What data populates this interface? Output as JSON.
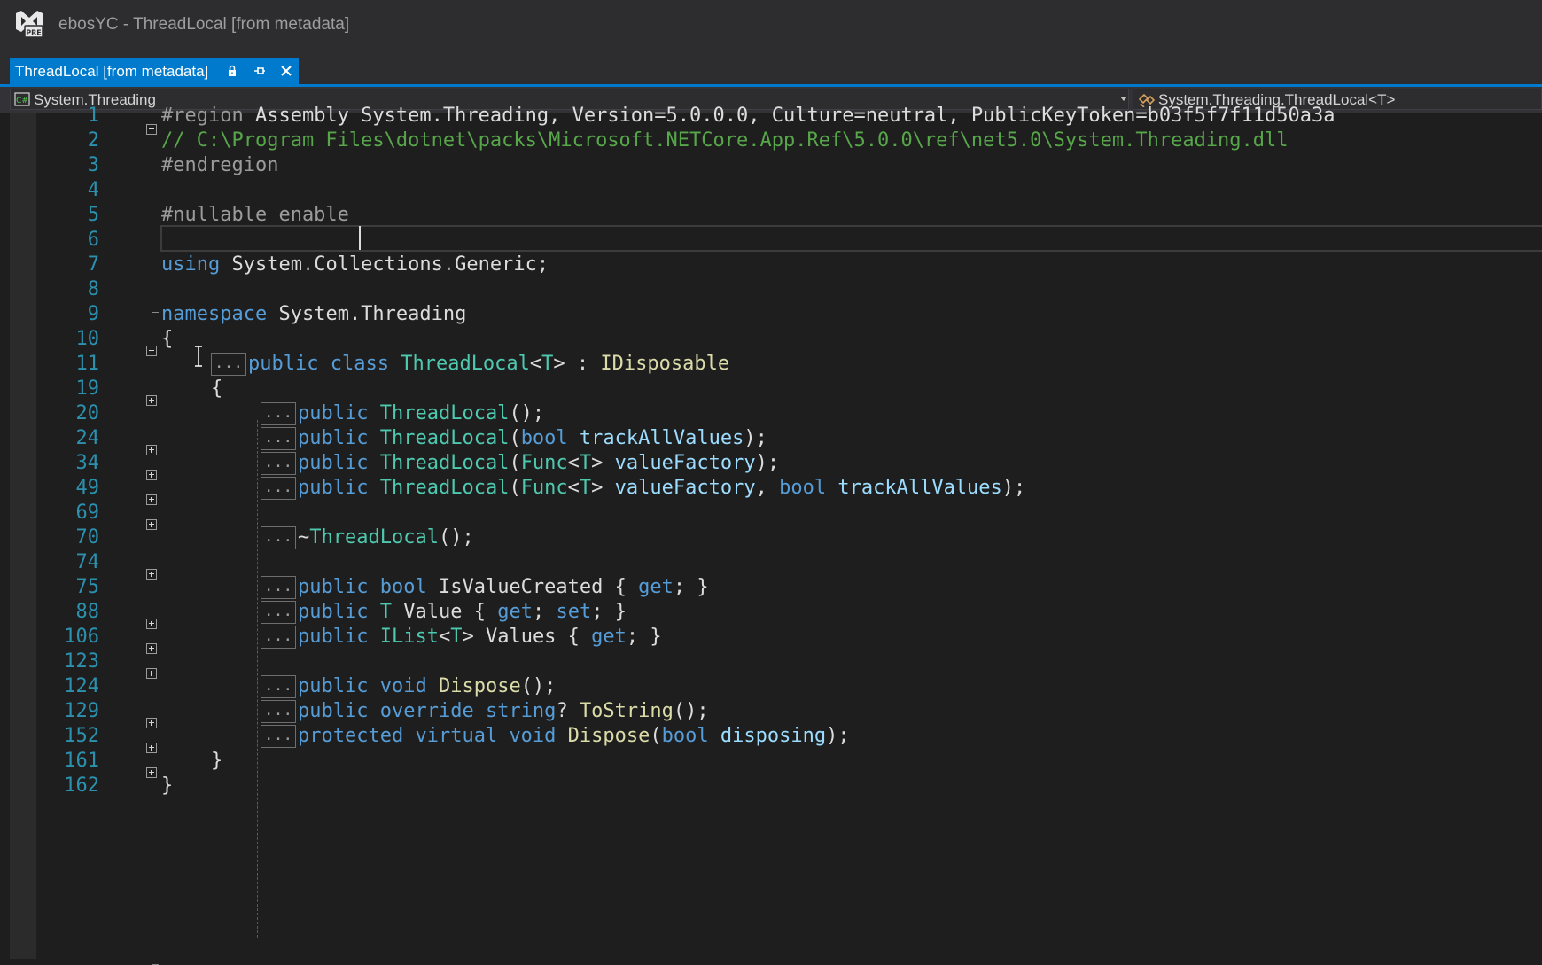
{
  "window": {
    "title": "ebosYC - ThreadLocal [from metadata]"
  },
  "tab": {
    "label": "ThreadLocal [from metadata]"
  },
  "navbar": {
    "project": "System.Threading",
    "member": "System.Threading.ThreadLocal<T>"
  },
  "icons": {
    "app": "visual-studio-preview-logo",
    "lock": "lock-icon",
    "pin": "pin-icon",
    "close": "close-icon",
    "csharp": "csharp-project-icon",
    "class": "class-icon"
  },
  "colors": {
    "keyword": "#569cd6",
    "type": "#4ec9b0",
    "method": "#dcdcaa",
    "parameter": "#9cdcfe",
    "comment": "#57a64a",
    "line_number": "#2b91af",
    "accent": "#007acc"
  },
  "editor": {
    "line_numbers": [
      "1",
      "2",
      "3",
      "4",
      "5",
      "6",
      "7",
      "8",
      "9",
      "10",
      "11",
      "19",
      "20",
      "24",
      "34",
      "49",
      "69",
      "70",
      "74",
      "75",
      "88",
      "106",
      "123",
      "124",
      "129",
      "152",
      "161",
      "162"
    ],
    "ellipsis": "...",
    "lines": {
      "l1": {
        "a": "#region",
        "b": " Assembly System.Threading, Version=5.0.0.0, Culture=neutral, PublicKeyToken=b03f5f7f11d50a3a"
      },
      "l2": {
        "a": "// C:\\Program Files\\dotnet\\packs\\Microsoft.NETCore.App.Ref\\5.0.0\\ref\\net5.0\\System.Threading.dll"
      },
      "l3": {
        "a": "#endregion"
      },
      "l5": {
        "a": "#nullable enable"
      },
      "l7": {
        "a": "using",
        "b": " System",
        "c": ".",
        "d": "Collections",
        "e": ".",
        "f": "Generic",
        "g": ";"
      },
      "l9": {
        "a": "namespace",
        "b": " System.Threading"
      },
      "l10": {
        "a": "{"
      },
      "l11": {
        "a": "public",
        "b": " ",
        "c": "class",
        "d": " ",
        "e": "ThreadLocal",
        "f": "<",
        "g": "T",
        "h": "> : ",
        "i": "IDisposable"
      },
      "l19": {
        "a": "{"
      },
      "l20": {
        "a": "public",
        "b": " ",
        "c": "ThreadLocal",
        "d": "();"
      },
      "l24": {
        "a": "public",
        "b": " ",
        "c": "ThreadLocal",
        "d": "(",
        "e": "bool",
        "f": " ",
        "g": "trackAllValues",
        "h": ");"
      },
      "l34": {
        "a": "public",
        "b": " ",
        "c": "ThreadLocal",
        "d": "(",
        "e": "Func",
        "f": "<",
        "g": "T",
        "h": "> ",
        "i": "valueFactory",
        "j": ");"
      },
      "l49": {
        "a": "public",
        "b": " ",
        "c": "ThreadLocal",
        "d": "(",
        "e": "Func",
        "f": "<",
        "g": "T",
        "h": "> ",
        "i": "valueFactory",
        "j": ", ",
        "k": "bool",
        "l": " ",
        "m": "trackAllValues",
        "n": ");"
      },
      "l70": {
        "a": "~",
        "b": "ThreadLocal",
        "c": "();"
      },
      "l75": {
        "a": "public",
        "b": " ",
        "c": "bool",
        "d": " IsValueCreated { ",
        "e": "get",
        "f": "; }"
      },
      "l88": {
        "a": "public",
        "b": " ",
        "c": "T",
        "d": " Value { ",
        "e": "get",
        "f": "; ",
        "g": "set",
        "h": "; }"
      },
      "l106": {
        "a": "public",
        "b": " ",
        "c": "IList",
        "d": "<",
        "e": "T",
        "f": "> Values { ",
        "g": "get",
        "h": "; }"
      },
      "l124": {
        "a": "public",
        "b": " ",
        "c": "void",
        "d": " ",
        "e": "Dispose",
        "f": "();"
      },
      "l129": {
        "a": "public",
        "b": " ",
        "c": "override",
        "d": " ",
        "e": "string",
        "f": "? ",
        "g": "ToString",
        "h": "();"
      },
      "l152": {
        "a": "protected",
        "b": " ",
        "c": "virtual",
        "d": " ",
        "e": "void",
        "f": " ",
        "g": "Dispose",
        "h": "(",
        "i": "bool",
        "j": " ",
        "k": "disposing",
        "l": ");"
      },
      "l161": {
        "a": "}"
      },
      "l162": {
        "a": "}"
      }
    }
  }
}
